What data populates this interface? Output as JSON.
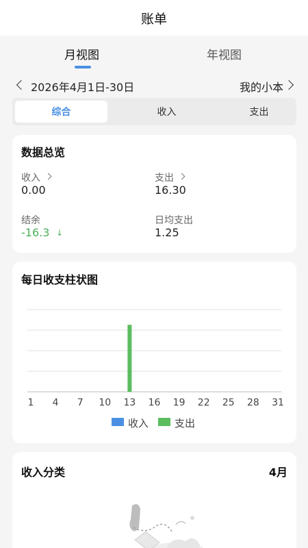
{
  "header": {
    "title": "账单"
  },
  "view_tabs": [
    {
      "label": "月视图",
      "active": true
    },
    {
      "label": "年视图",
      "active": false
    }
  ],
  "date_bar": {
    "range": "2026年4月1日-30日",
    "book": "我的小本"
  },
  "seg_tabs": [
    {
      "label": "综合",
      "active": true
    },
    {
      "label": "收入",
      "active": false
    },
    {
      "label": "支出",
      "active": false
    }
  ],
  "summary": {
    "title": "数据总览",
    "income_label": "收入",
    "income_value": "0.00",
    "expense_label": "支出",
    "expense_value": "16.30",
    "balance_label": "结余",
    "balance_value": "-16.3",
    "balance_arrow": "↓",
    "daily_expense_label": "日均支出",
    "daily_expense_value": "1.25"
  },
  "chart_data": {
    "type": "bar",
    "title": "每日收支柱状图",
    "x": [
      1,
      2,
      3,
      4,
      5,
      6,
      7,
      8,
      9,
      10,
      11,
      12,
      13,
      14,
      15,
      16,
      17,
      18,
      19,
      20,
      21,
      22,
      23,
      24,
      25,
      26,
      27,
      28,
      29,
      30,
      31
    ],
    "tick_labels": [
      "1",
      "4",
      "7",
      "10",
      "13",
      "16",
      "19",
      "22",
      "25",
      "28",
      "31"
    ],
    "ylim": [
      0,
      20
    ],
    "grid": true,
    "legend_placement": "bottom",
    "series": [
      {
        "name": "收入",
        "color": "#4a90e2",
        "values": [
          0,
          0,
          0,
          0,
          0,
          0,
          0,
          0,
          0,
          0,
          0,
          0,
          0,
          0,
          0,
          0,
          0,
          0,
          0,
          0,
          0,
          0,
          0,
          0,
          0,
          0,
          0,
          0,
          0,
          0,
          0
        ]
      },
      {
        "name": "支出",
        "color": "#5cbd5f",
        "values": [
          0,
          0,
          0,
          0,
          0,
          0,
          0,
          0,
          0,
          0,
          0,
          0,
          16.3,
          0,
          0,
          0,
          0,
          0,
          0,
          0,
          0,
          0,
          0,
          0,
          0,
          0,
          0,
          0,
          0,
          0,
          0
        ]
      }
    ]
  },
  "category": {
    "title": "收入分类",
    "month": "4月"
  },
  "icons": {
    "back": "chevron-left-icon",
    "forward": "chevron-right-icon",
    "empty": "empty-state-illustration"
  }
}
